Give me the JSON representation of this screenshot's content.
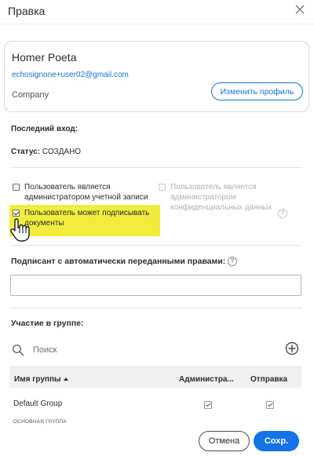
{
  "dialog": {
    "title": "Правка",
    "close_icon": "close-icon"
  },
  "profile": {
    "name": "Homer Poeta",
    "email": "echosignone+user02@gmail.com",
    "company": "Company",
    "edit_button": "Изменить профиль"
  },
  "meta": {
    "last_login_label": "Последний вход:",
    "status_label": "Статус:",
    "status_value": "СОЗДАНО"
  },
  "options": {
    "account_admin": {
      "line1": "Пользователь является",
      "line2": "администратором учетной записи",
      "checked": false
    },
    "privacy_admin": {
      "line1": "Пользователь является",
      "line2": "администратором",
      "line3": "конфиденциальных данных",
      "checked": false,
      "disabled": true
    },
    "can_sign": {
      "line1": "Пользователь может подписывать",
      "line2": "документы",
      "checked": true,
      "highlight_color": "#f2ec3c"
    }
  },
  "signer": {
    "label": "Подписант с автоматически переданными правами:",
    "value": ""
  },
  "groups": {
    "label": "Участие в группе:",
    "search_placeholder": "Поиск",
    "columns": {
      "name": "Имя группы",
      "admin": "Администра...",
      "send": "Отправка"
    },
    "rows": [
      {
        "name": "Default Group",
        "sub": "ОСНОВНАЯ ГРУППА",
        "admin": true,
        "send": true
      }
    ]
  },
  "footer": {
    "cancel": "Отмена",
    "save": "Сохр."
  },
  "colors": {
    "accent": "#1473e6",
    "highlight": "#f2ec3c"
  }
}
